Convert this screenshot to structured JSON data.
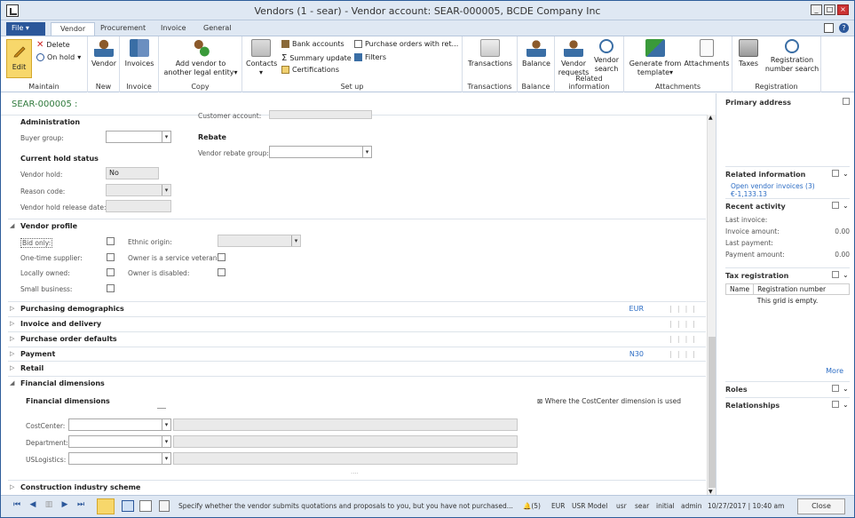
{
  "window": {
    "title": "Vendors (1 - sear) - Vendor account: SEAR-000005, BCDE Company Inc"
  },
  "tabs": [
    {
      "label": "File"
    },
    {
      "label": "Vendor"
    },
    {
      "label": "Procurement"
    },
    {
      "label": "Invoice"
    },
    {
      "label": "General"
    }
  ],
  "ribbon": {
    "maintain": {
      "edit": "Edit",
      "delete": "Delete",
      "on_hold": "On hold",
      "label": "Maintain"
    },
    "new": {
      "vendor": "Vendor",
      "label": "New"
    },
    "invoice": {
      "invoices": "Invoices",
      "label": "Invoice"
    },
    "copy": {
      "add_vendor": "Add vendor to",
      "another": "another legal entity",
      "label": "Copy"
    },
    "setup": {
      "contacts": "Contacts",
      "bank_accounts": "Bank accounts",
      "summary_update": "Summary update",
      "certifications": "Certifications",
      "purchase_orders": "Purchase orders with ret...",
      "filters": "Filters",
      "label": "Set up"
    },
    "transactions": {
      "transactions": "Transactions",
      "label": "Transactions"
    },
    "balance": {
      "balance": "Balance",
      "label": "Balance"
    },
    "related": {
      "vendor_requests_1": "Vendor",
      "vendor_requests_2": "requests",
      "vendor_search_1": "Vendor",
      "vendor_search_2": "search",
      "label": "Related information"
    },
    "attachments": {
      "generate_1": "Generate from",
      "generate_2": "template",
      "attachments": "Attachments",
      "label": "Attachments"
    },
    "registration": {
      "taxes": "Taxes",
      "reg_1": "Registration",
      "reg_2": "number search",
      "label": "Registration"
    }
  },
  "record_id": "SEAR-000005 :",
  "form": {
    "customer_account_label": "Customer account:",
    "administration": "Administration",
    "buyer_group_label": "Buyer group:",
    "rebate": "Rebate",
    "vendor_rebate_group_label": "Vendor rebate group:",
    "current_hold_status": "Current hold status",
    "vendor_hold_label": "Vendor hold:",
    "vendor_hold_value": "No",
    "reason_code_label": "Reason code:",
    "hold_release_label": "Vendor hold release date:",
    "vendor_profile": "Vendor profile",
    "bid_only": "Bid only:",
    "ethnic_origin": "Ethnic origin:",
    "one_time_supplier": "One-time supplier:",
    "service_veteran": "Owner is a service veteran:",
    "locally_owned": "Locally owned:",
    "owner_disabled": "Owner is disabled:",
    "small_business": "Small business:",
    "financial_dimensions": "Financial dimensions",
    "financial_dimensions_sub": "Financial dimensions",
    "where_cost_center": "Where the CostCenter dimension is used",
    "cost_center": "CostCenter:",
    "department": "Department:",
    "uslogistics": "USLogistics:"
  },
  "sections": [
    {
      "title": "Purchasing demographics",
      "value": "EUR"
    },
    {
      "title": "Invoice and delivery",
      "value": ""
    },
    {
      "title": "Purchase order defaults",
      "value": ""
    },
    {
      "title": "Payment",
      "value": "N30"
    },
    {
      "title": "Retail",
      "value": ""
    }
  ],
  "construction": "Construction industry scheme",
  "side": {
    "primary_address": "Primary address",
    "related_information": "Related information",
    "open_invoices": "Open vendor invoices (3) €-1,133.13",
    "recent_activity": "Recent activity",
    "last_invoice": "Last invoice:",
    "invoice_amount": "Invoice amount:",
    "invoice_amount_value": "0.00",
    "last_payment": "Last payment:",
    "payment_amount": "Payment amount:",
    "payment_amount_value": "0.00",
    "tax_registration": "Tax registration",
    "col_name": "Name",
    "col_reg": "Registration number",
    "grid_empty": "This grid is empty.",
    "more": "More",
    "roles": "Roles",
    "relationships": "Relationships"
  },
  "status": {
    "message": "Specify whether the vendor submits quotations and proposals to you, but you have not purchased...",
    "count": "(5)",
    "currency": "EUR",
    "model": "USR Model",
    "company": "usr",
    "user": "sear",
    "layer": "initial",
    "role": "admin",
    "datetime": "10/27/2017 | 10:40 am",
    "close": "Close"
  }
}
